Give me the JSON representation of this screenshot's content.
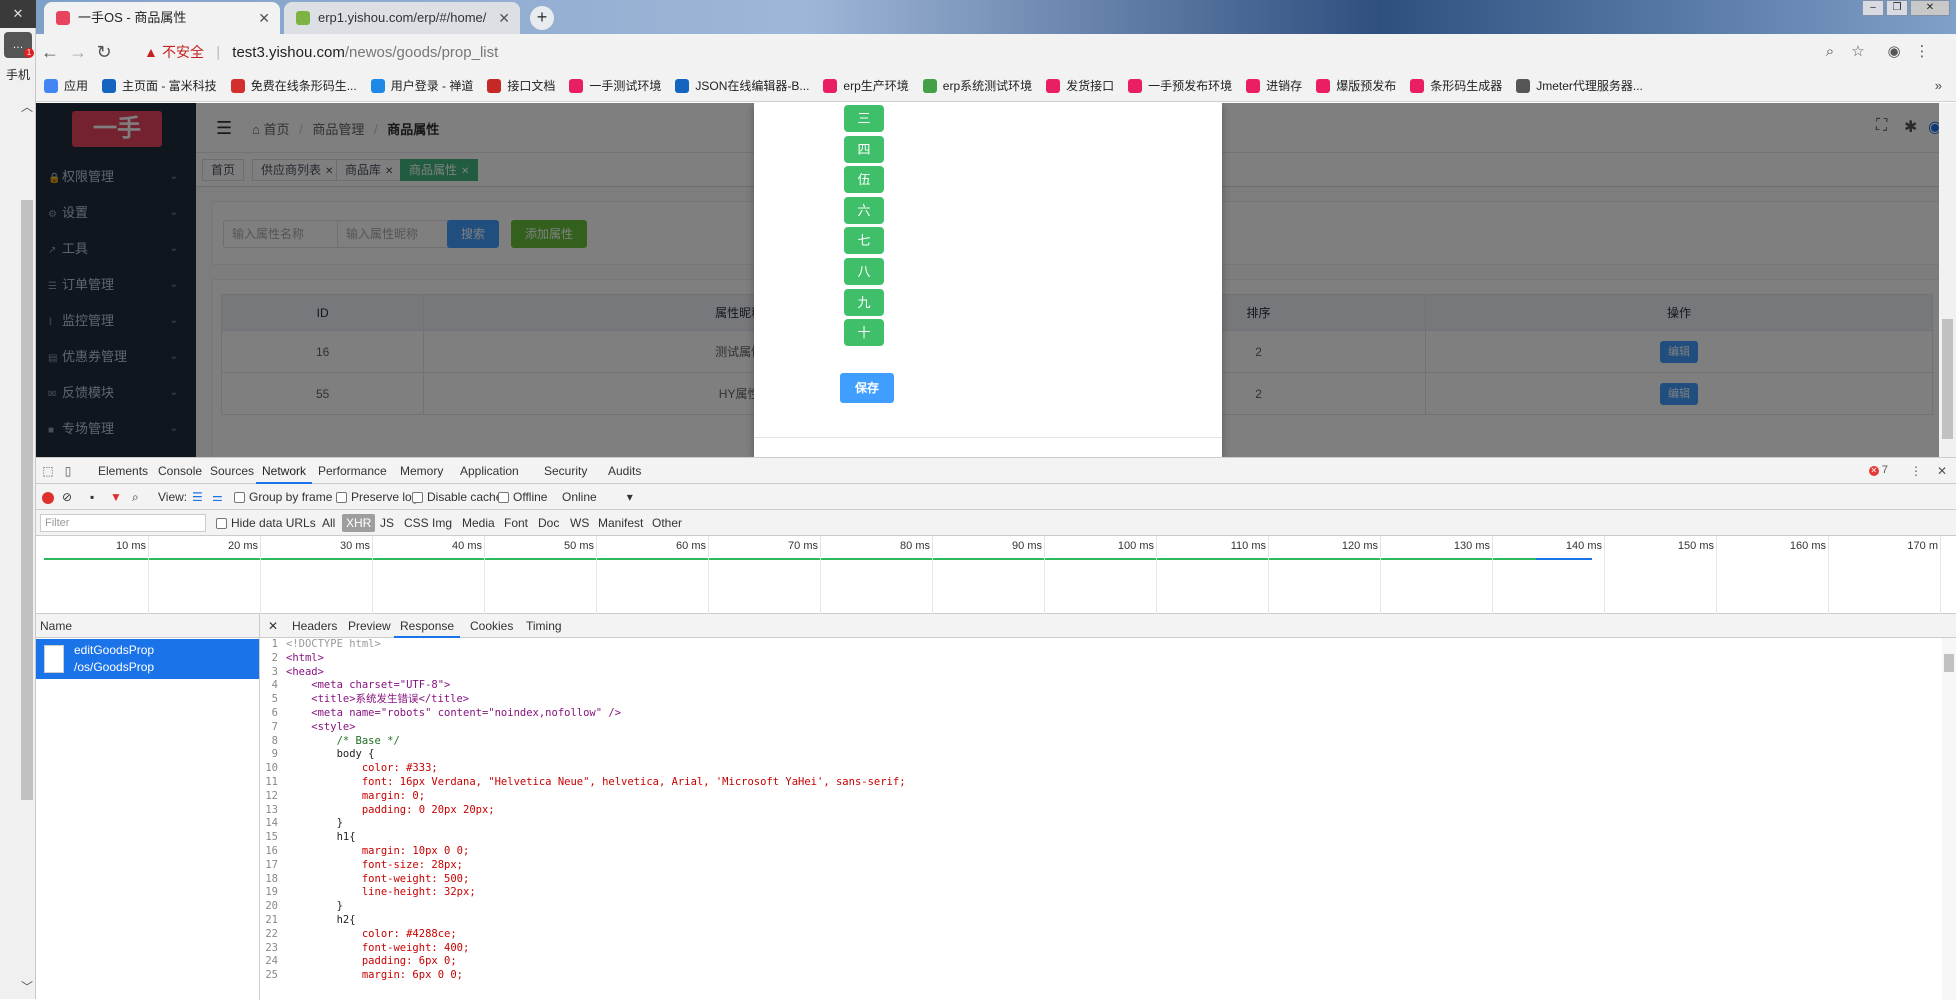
{
  "left_strip": {
    "top_text": "✕",
    "app_label": "手机",
    "badge": "1",
    "icon_text": "…"
  },
  "browser": {
    "tabs": [
      {
        "title": "一手OS - 商品属性",
        "active": true
      },
      {
        "title": "erp1.yishou.com/erp/#/home/",
        "active": false
      }
    ],
    "newtab": "+",
    "address": {
      "warning_label": "不安全",
      "host": "test3.yishou.com",
      "path": "/newos/goods/prop_list"
    },
    "bookmarks": [
      {
        "label": "应用",
        "color": "#4285f4"
      },
      {
        "label": "主页面 - 富米科技",
        "color": "#1565c0"
      },
      {
        "label": "免费在线条形码生...",
        "color": "#d32f2f"
      },
      {
        "label": "用户登录 - 禅道",
        "color": "#1e88e5"
      },
      {
        "label": "接口文档",
        "color": "#c62828"
      },
      {
        "label": "一手测试环境",
        "color": "#e91e63"
      },
      {
        "label": "JSON在线编辑器-B...",
        "color": "#1565c0"
      },
      {
        "label": "erp生产环境",
        "color": "#e91e63"
      },
      {
        "label": "erp系统测试环境",
        "color": "#43a047"
      },
      {
        "label": "发货接口",
        "color": "#e91e63"
      },
      {
        "label": "一手预发布环境",
        "color": "#e91e63"
      },
      {
        "label": "进销存",
        "color": "#e91e63"
      },
      {
        "label": "爆版预发布",
        "color": "#e91e63"
      },
      {
        "label": "条形码生成器",
        "color": "#e91e63"
      },
      {
        "label": "Jmeter代理服务器...",
        "color": "#555555"
      }
    ],
    "bookmarks_more": "»"
  },
  "app": {
    "logo": "一手",
    "menu": [
      {
        "label": "权限管理"
      },
      {
        "label": "设置"
      },
      {
        "label": "工具"
      },
      {
        "label": "订单管理"
      },
      {
        "label": "监控管理"
      },
      {
        "label": "优惠券管理"
      },
      {
        "label": "反馈模块"
      },
      {
        "label": "专场管理"
      }
    ],
    "breadcrumb": {
      "home": "首页",
      "parent": "商品管理",
      "current": "商品属性"
    },
    "tags": [
      {
        "label": "首页",
        "closable": false
      },
      {
        "label": "供应商列表",
        "closable": true
      },
      {
        "label": "商品库",
        "closable": true
      },
      {
        "label": "商品属性",
        "closable": true,
        "active": true
      }
    ],
    "search": {
      "name_placeholder": "输入属性名称",
      "alias_placeholder": "输入属性昵称",
      "search_button": "搜索",
      "add_button": "添加属性"
    },
    "table": {
      "headers": [
        "ID",
        "属性昵称",
        "",
        "排序",
        "操作"
      ],
      "rows": [
        {
          "id": "16",
          "alias": "测试属性",
          "sort": "2",
          "action": "编辑"
        },
        {
          "id": "55",
          "alias": "HY属性",
          "sort": "2",
          "action": "编辑"
        }
      ]
    },
    "dialog": {
      "numbers": [
        "三",
        "四",
        "伍",
        "六",
        "七",
        "八",
        "九",
        "十"
      ],
      "save_button": "保存"
    }
  },
  "devtools": {
    "tabs": [
      "Elements",
      "Console",
      "Sources",
      "Network",
      "Performance",
      "Memory",
      "Application",
      "Security",
      "Audits"
    ],
    "active_tab": "Network",
    "error_count": "7",
    "toolbar": {
      "view_label": "View:",
      "group_by_frame": "Group by frame",
      "preserve_log": "Preserve log",
      "disable_cache": "Disable cache",
      "offline": "Offline",
      "throttle": "Online"
    },
    "filter": {
      "placeholder": "Filter",
      "hide_data_urls": "Hide data URLs",
      "types": [
        "All",
        "XHR",
        "JS",
        "CSS",
        "Img",
        "Media",
        "Font",
        "Doc",
        "WS",
        "Manifest",
        "Other"
      ],
      "active_type": "XHR"
    },
    "timeline_labels": [
      "10 ms",
      "20 ms",
      "30 ms",
      "40 ms",
      "50 ms",
      "60 ms",
      "70 ms",
      "80 ms",
      "90 ms",
      "100 ms",
      "110 ms",
      "120 ms",
      "130 ms",
      "140 ms",
      "150 ms",
      "160 ms",
      "170 m"
    ],
    "name_header": "Name",
    "request": {
      "name": "editGoodsProp",
      "path": "/os/GoodsProp"
    },
    "detail_tabs": [
      "Headers",
      "Preview",
      "Response",
      "Cookies",
      "Timing"
    ],
    "active_detail_tab": "Response",
    "response_lines": [
      "<!DOCTYPE html>",
      "<html>",
      "<head>",
      "    <meta charset=\"UTF-8\">",
      "    <title>系统发生错误</title>",
      "    <meta name=\"robots\" content=\"noindex,nofollow\" />",
      "    <style>",
      "        /* Base */",
      "        body {",
      "            color: #333;",
      "            font: 16px Verdana, \"Helvetica Neue\", helvetica, Arial, 'Microsoft YaHei', sans-serif;",
      "            margin: 0;",
      "            padding: 0 20px 20px;",
      "        }",
      "        h1{",
      "            margin: 10px 0 0;",
      "            font-size: 28px;",
      "            font-weight: 500;",
      "            line-height: 32px;",
      "        }",
      "        h2{",
      "            color: #4288ce;",
      "            font-weight: 400;",
      "            padding: 6px 0;",
      "            margin: 6px 0 0;"
    ]
  }
}
